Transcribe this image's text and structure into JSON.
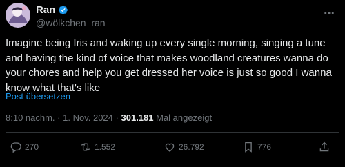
{
  "tweet": {
    "display_name": "Ran",
    "handle": "@wölkchen_ran",
    "text": "Imagine being Iris and waking up every single morning, singing a tune and having the kind of voice that makes woodland creatures wanna do your chores and help you get dressed her voice is just so good I wanna know what that's like",
    "translate_label": "Post übersetzen",
    "time": "8:10 nachm.",
    "date": "1. Nov. 2024",
    "separator": "·",
    "views_count": "301.181",
    "views_label": "Mal angezeigt"
  },
  "actions": {
    "replies": "270",
    "reposts": "1.552",
    "likes": "26.792",
    "bookmarks": "776"
  },
  "colors": {
    "background": "#000000",
    "text": "#e7e9ea",
    "muted": "#71767b",
    "accent": "#1d9bf0",
    "verified": "#1d9bf0"
  },
  "icons": {
    "verified": "verified-badge-icon",
    "more": "more-dots-icon",
    "reply": "reply-icon",
    "repost": "repost-icon",
    "like": "heart-icon",
    "bookmark": "bookmark-icon",
    "share": "share-icon"
  }
}
